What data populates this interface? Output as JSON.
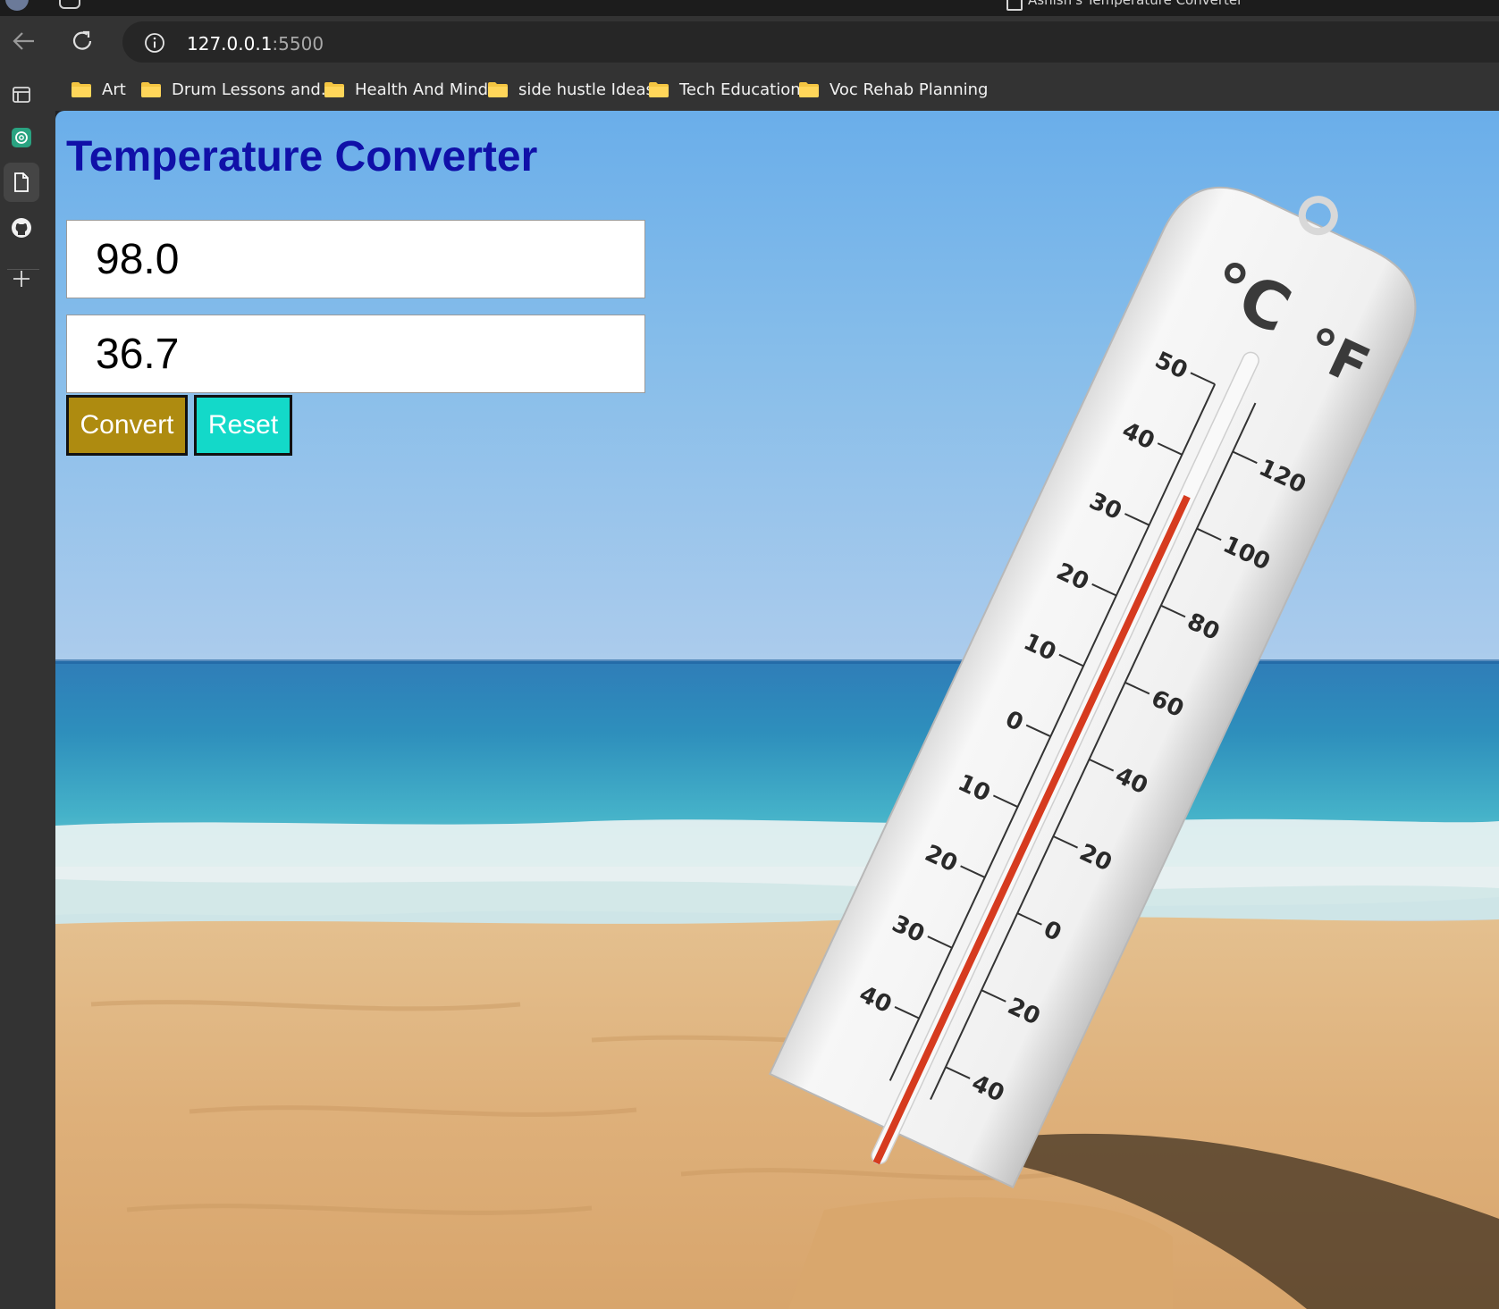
{
  "browser": {
    "tab_title": "Ashish's Temperature Converter",
    "url_host": "127.0.0.1",
    "url_port": ":5500"
  },
  "bookmarks": [
    "Art",
    "Drum Lessons and...",
    "Health And Mind",
    "side hustle Ideas",
    "Tech Education",
    "Voc Rehab Planning"
  ],
  "page": {
    "title": "Temperature Converter",
    "fahrenheit_value": "98.0",
    "celsius_value": "36.7",
    "convert_label": "Convert",
    "reset_label": "Reset"
  },
  "background": {
    "unit_celsius": "°C",
    "unit_fahrenheit": "°F",
    "celsius_ticks": [
      "50",
      "40",
      "30",
      "20",
      "10",
      "0",
      "10",
      "20",
      "30",
      "40"
    ],
    "fahrenheit_ticks": [
      "120",
      "100",
      "80",
      "60",
      "40",
      "20",
      "0",
      "20",
      "40"
    ]
  },
  "colors": {
    "title": "#1010a8",
    "convert_button": "#ae8b10",
    "reset_button": "#13d9c9"
  }
}
